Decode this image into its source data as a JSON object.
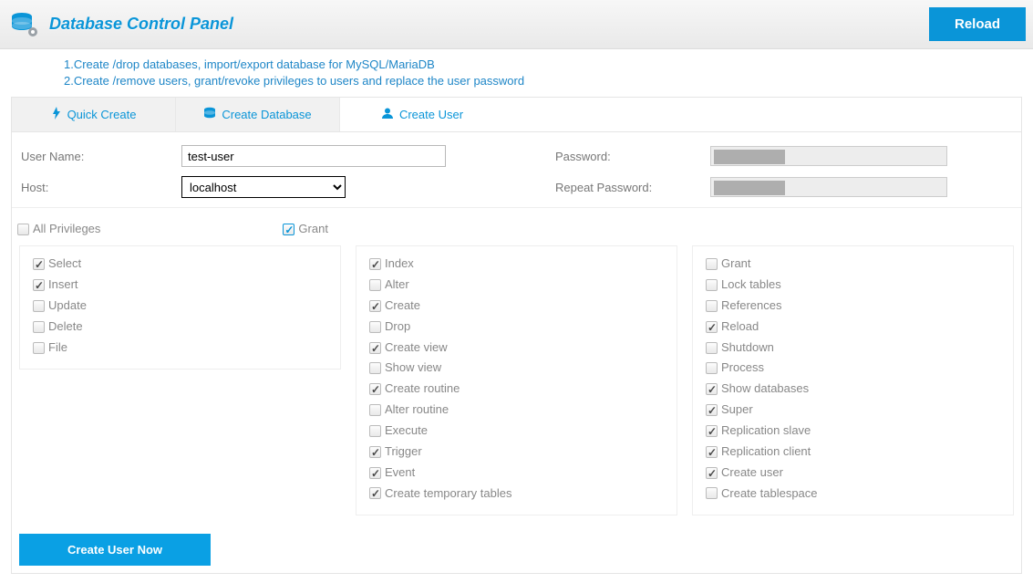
{
  "header": {
    "title": "Database Control Panel",
    "reload": "Reload",
    "info1": "1.Create /drop databases, import/export database for MySQL/MariaDB",
    "info2": "2.Create /remove users, grant/revoke privileges to users and replace the user password"
  },
  "tabs": {
    "quick_create": "Quick Create",
    "create_database": "Create Database",
    "create_user": "Create User"
  },
  "form": {
    "username_label": "User Name:",
    "username_value": "test-user",
    "host_label": "Host:",
    "host_value": "localhost",
    "password_label": "Password:",
    "repeat_password_label": "Repeat Password:"
  },
  "priv_top": {
    "all": "All Privileges",
    "grant": "Grant"
  },
  "col1": [
    {
      "label": "Select",
      "checked": true
    },
    {
      "label": "Insert",
      "checked": true
    },
    {
      "label": "Update",
      "checked": false
    },
    {
      "label": "Delete",
      "checked": false
    },
    {
      "label": "File",
      "checked": false
    }
  ],
  "col2": [
    {
      "label": "Index",
      "checked": true
    },
    {
      "label": "Alter",
      "checked": false
    },
    {
      "label": "Create",
      "checked": true
    },
    {
      "label": "Drop",
      "checked": false
    },
    {
      "label": "Create view",
      "checked": true
    },
    {
      "label": "Show view",
      "checked": false
    },
    {
      "label": "Create routine",
      "checked": true
    },
    {
      "label": "Alter routine",
      "checked": false
    },
    {
      "label": "Execute",
      "checked": false
    },
    {
      "label": "Trigger",
      "checked": true
    },
    {
      "label": "Event",
      "checked": true
    },
    {
      "label": "Create temporary tables",
      "checked": true
    }
  ],
  "col3": [
    {
      "label": "Grant",
      "checked": false
    },
    {
      "label": "Lock tables",
      "checked": false
    },
    {
      "label": "References",
      "checked": false
    },
    {
      "label": "Reload",
      "checked": true
    },
    {
      "label": "Shutdown",
      "checked": false
    },
    {
      "label": "Process",
      "checked": false
    },
    {
      "label": "Show databases",
      "checked": true
    },
    {
      "label": "Super",
      "checked": true
    },
    {
      "label": "Replication slave",
      "checked": true
    },
    {
      "label": "Replication client",
      "checked": true
    },
    {
      "label": "Create user",
      "checked": true
    },
    {
      "label": "Create tablespace",
      "checked": false
    }
  ],
  "buttons": {
    "create_user": "Create User Now"
  }
}
